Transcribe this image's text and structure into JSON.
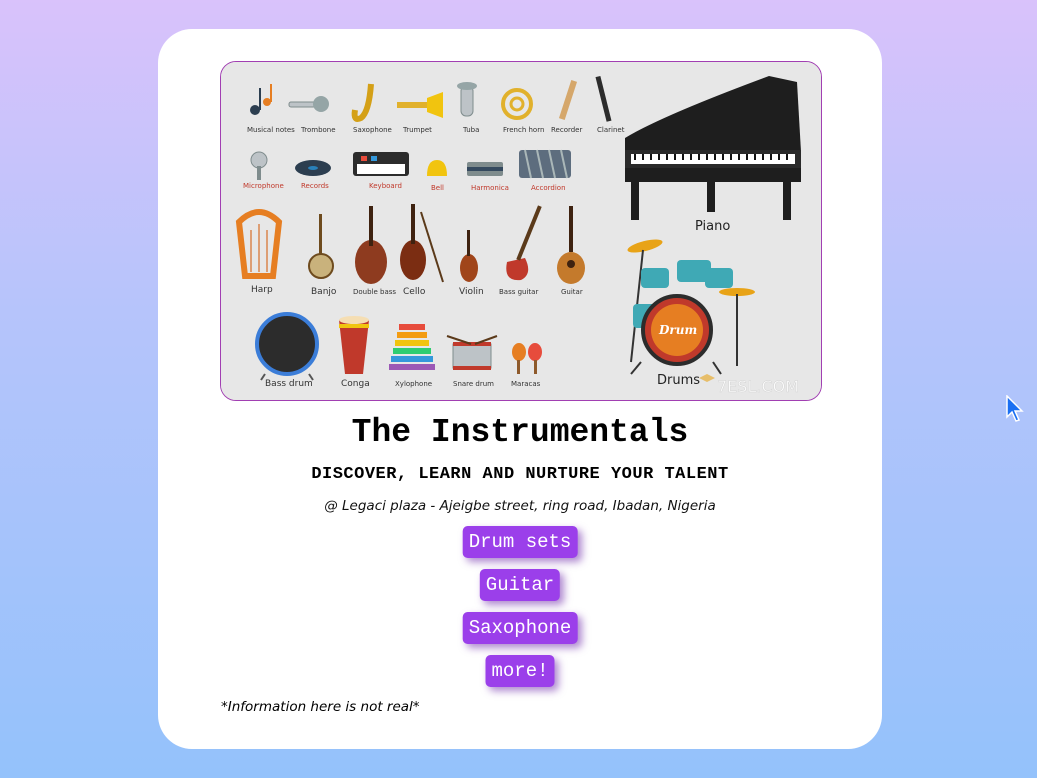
{
  "banner": {
    "row1": [
      "Musical notes",
      "Trombone",
      "Saxophone",
      "Trumpet",
      "Tuba",
      "French horn",
      "Recorder",
      "Clarinet"
    ],
    "row2": [
      "Microphone",
      "Records",
      "Keyboard",
      "Bell",
      "Harmonica",
      "Accordion"
    ],
    "row3": [
      "Harp",
      "Banjo",
      "Double bass",
      "Cello",
      "Violin",
      "Bass guitar",
      "Guitar"
    ],
    "row4": [
      "Bass drum",
      "Conga",
      "Xylophone",
      "Snare drum",
      "Maracas"
    ],
    "piano": "Piano",
    "drums": "Drums",
    "drum_head": "Drum",
    "watermark": "7ESL.COM"
  },
  "header": {
    "title": "The Instrumentals",
    "tagline": "DISCOVER, LEARN AND NURTURE YOUR TALENT",
    "address": "@ Legaci plaza - Ajeigbe street, ring road, Ibadan, Nigeria"
  },
  "buttons": {
    "drum_sets": "Drum sets",
    "guitar": "Guitar",
    "saxophone": "Saxophone",
    "more": "more!"
  },
  "footer": {
    "note": "*Information here is not real*"
  },
  "colors": {
    "button": "#9b3fea",
    "banner_border": "#a13fb2"
  },
  "icons": {
    "cursor": "mouse-pointer-icon"
  }
}
